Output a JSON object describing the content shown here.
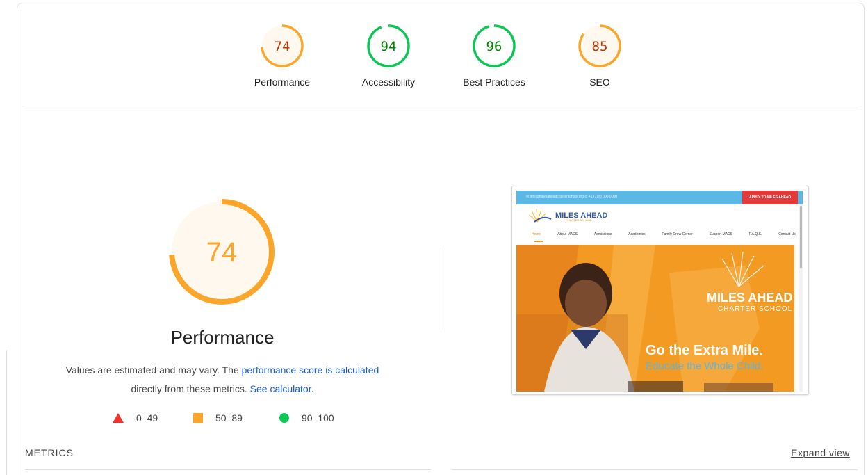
{
  "summary": {
    "gauges": [
      {
        "score": "74",
        "label": "Performance",
        "color": "#fba62a",
        "text_color": "#c33300",
        "bg": "#fff8ee",
        "fraction": 0.74
      },
      {
        "score": "94",
        "label": "Accessibility",
        "color": "#0bc653",
        "text_color": "#008800",
        "bg": "#ffffff",
        "fraction": 0.94
      },
      {
        "score": "96",
        "label": "Best Practices",
        "color": "#0bc653",
        "text_color": "#008800",
        "bg": "#ffffff",
        "fraction": 0.96
      },
      {
        "score": "85",
        "label": "SEO",
        "color": "#fba62a",
        "text_color": "#c33300",
        "bg": "#fff8ee",
        "fraction": 0.85
      }
    ]
  },
  "performance": {
    "score": "74",
    "fraction": 0.74,
    "color": "#fba62a",
    "title": "Performance",
    "desc_prefix": "Values are estimated and may vary. The ",
    "desc_link": "performance score is calculated",
    "desc_middle": "directly from these metrics. ",
    "desc_link2": "See calculator.",
    "legend": {
      "fail": "0–49",
      "average": "50–89",
      "pass": "90–100"
    }
  },
  "thumbnail": {
    "topbar_text": "✉ info@milesaheadcharterschool.org   ✆ +1 (716) 000-0000",
    "apply_label": "APPLY TO MILES AHEAD",
    "logo_name": "MILES AHEAD",
    "logo_sub": "CHARTER SCHOOL",
    "nav": [
      "Home",
      "About MACS",
      "Admissions",
      "Academics",
      "Family Crew Corner",
      "Support MACS",
      "F.A.Q.S.",
      "Contact Us"
    ],
    "hero_brand": "MILES AHEAD",
    "hero_brand_sub": "CHARTER SCHOOL",
    "hero_line1": "Go the Extra Mile.",
    "hero_line2": "Educate the Whole Child."
  },
  "metrics": {
    "label": "METRICS",
    "expand": "Expand view"
  }
}
